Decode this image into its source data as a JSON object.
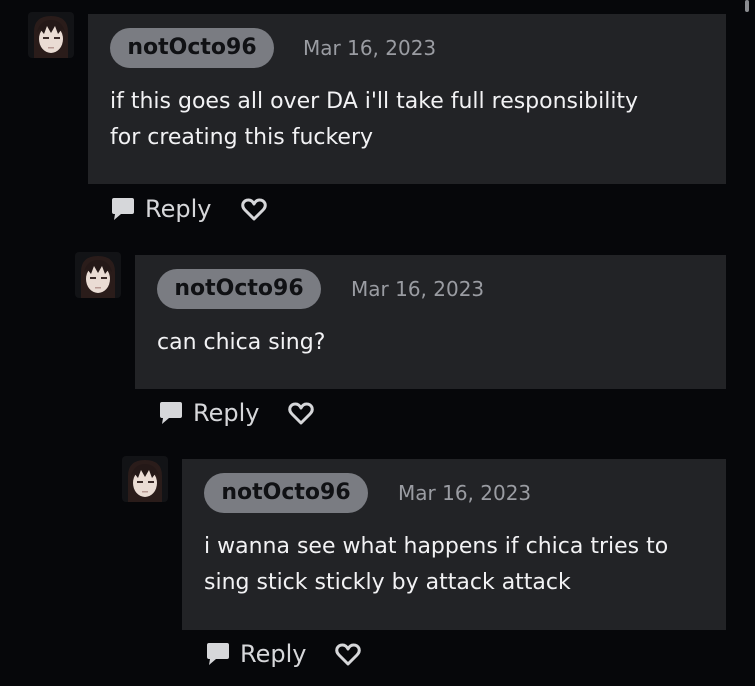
{
  "comments": [
    {
      "username": "notOcto96",
      "date": "Mar 16, 2023",
      "lines": [
        "if this goes all over DA i'll take full responsibility",
        "for creating this fuckery"
      ],
      "reply_label": "Reply"
    },
    {
      "username": "notOcto96",
      "date": "Mar 16, 2023",
      "lines": [
        "can chica sing?"
      ],
      "reply_label": "Reply"
    },
    {
      "username": "notOcto96",
      "date": "Mar 16, 2023",
      "lines": [
        "i wanna see what happens if chica tries to",
        "sing stick stickly by attack attack"
      ],
      "reply_label": "Reply"
    }
  ],
  "icons": {
    "reply": "speech-bubble-icon",
    "like": "heart-outline-icon"
  },
  "colors": {
    "background": "#06070a",
    "card": "#222326",
    "username_pill": "#7a7c82",
    "text": "#f2f2f4",
    "muted": "#9a9ca2"
  }
}
